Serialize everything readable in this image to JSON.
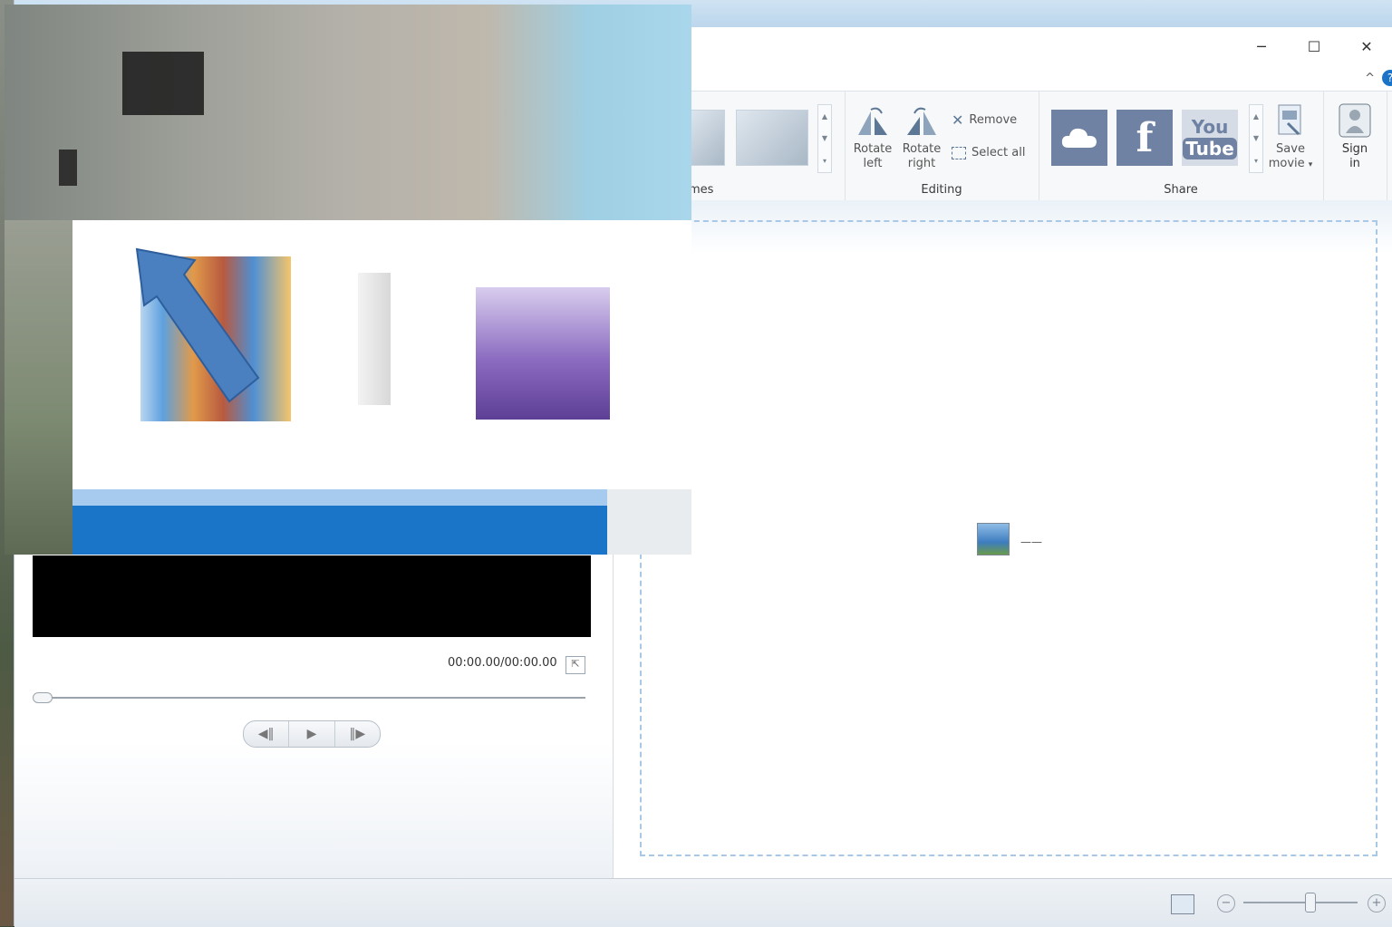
{
  "window": {
    "minimize": "─",
    "maximize": "☐",
    "close": "✕",
    "collapse_ribbon": "^",
    "help": "?"
  },
  "ribbon": {
    "themes_partial_label": "mes",
    "editing": {
      "group_label": "Editing",
      "rotate_left_line1": "Rotate",
      "rotate_left_line2": "left",
      "rotate_right_line1": "Rotate",
      "rotate_right_line2": "right",
      "remove": "Remove",
      "select_all": "Select all"
    },
    "share": {
      "group_label": "Share",
      "onedrive": "cloud-icon",
      "facebook": "f",
      "youtube_line1": "You",
      "youtube_line2": "Tube",
      "save_movie_line1": "Save",
      "save_movie_line2": "movie"
    },
    "sign_in_line1": "Sign",
    "sign_in_line2": "in"
  },
  "preview": {
    "time": "00:00.00/00:00.00",
    "fullscreen": "⇱",
    "prev_frame": "◀‖",
    "play": "▶",
    "next_frame": "‖▶"
  },
  "storyboard": {
    "placeholder_dash": "——"
  },
  "statusbar": {
    "zoom_out": "−",
    "zoom_in": "+",
    "zoom_level": 0.58
  },
  "colors": {
    "accent_blue": "#1a74c8",
    "ribbon_bg": "#f7f8fa",
    "dashed_border": "#a9c8e6"
  }
}
